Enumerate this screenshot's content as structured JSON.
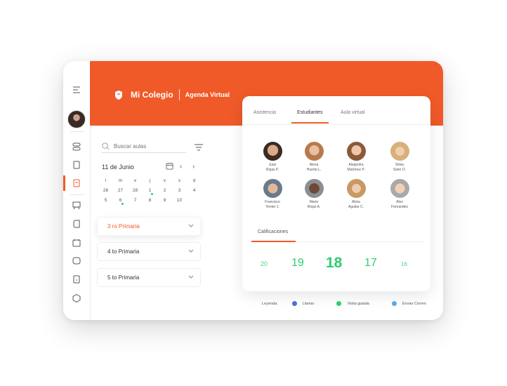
{
  "brand": {
    "name": "Mi Colegio",
    "section": "Agenda Virtual"
  },
  "search": {
    "placeholder": "Buscar aulas"
  },
  "calendar": {
    "title": "11 de Junio",
    "weekdays": [
      "l",
      "m",
      "x",
      "j",
      "v",
      "s",
      "d"
    ],
    "rows": [
      [
        "26",
        "27",
        "28",
        "1",
        "2",
        "3",
        "4"
      ],
      [
        "5",
        "6",
        "7",
        "8",
        "9",
        "10",
        "11"
      ]
    ],
    "today": "11",
    "dotted_days": [
      "1",
      "6"
    ]
  },
  "classes": [
    {
      "label": "3 ro Primaria",
      "active": true
    },
    {
      "label": "4 to Primaria",
      "active": false
    },
    {
      "label": "5 to Primaria",
      "active": false
    }
  ],
  "tabs": [
    "Asistencia",
    "Estudiantes",
    "Aula virtual"
  ],
  "active_tab": "Estudiantes",
  "students": [
    {
      "first": "Juan",
      "last": "Rojas P."
    },
    {
      "first": "Alexa",
      "last": "Huerta L."
    },
    {
      "first": "Alejandra",
      "last": "Martínez P."
    },
    {
      "first": "Silvia",
      "last": "Soler O."
    },
    {
      "first": "Francisco",
      "last": "Yenter J."
    },
    {
      "first": "Mario",
      "last": "Rojas A."
    },
    {
      "first": "Alicia",
      "last": "Aguilar C."
    },
    {
      "first": "Alex",
      "last": "Fernandez"
    }
  ],
  "grades": {
    "label": "Calificaciones",
    "values": [
      "20",
      "19",
      "18",
      "17",
      "16"
    ]
  },
  "legend": {
    "label": "Leyenda:",
    "items": [
      {
        "text": "Llamar",
        "color": "#4a6fd8"
      },
      {
        "text": "Visita guiada",
        "color": "#2ecc71"
      },
      {
        "text": "Enviar Correo",
        "color": "#5aa9e6"
      }
    ]
  },
  "colors": {
    "accent": "#f05a28",
    "grade": "#2ecc71"
  }
}
